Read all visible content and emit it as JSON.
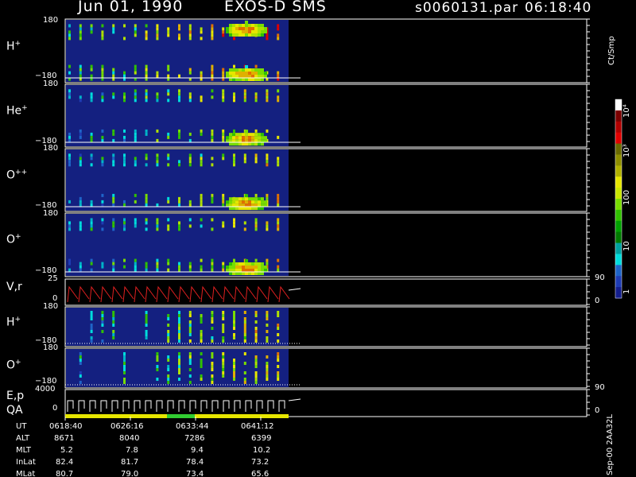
{
  "header": {
    "date": "Jun 01, 1990",
    "instrument": "EXOS-D SMS",
    "file": "s0060131.par",
    "time": "06:18:40"
  },
  "panels": [
    {
      "id": "p1",
      "label": "H",
      "sup": "+",
      "y_top": "180",
      "y_bottom": "−180"
    },
    {
      "id": "p2",
      "label": "He",
      "sup": "+",
      "y_top": "180",
      "y_bottom": "−180"
    },
    {
      "id": "p3",
      "label": "O",
      "sup": "++",
      "y_top": "180",
      "y_bottom": "−180"
    },
    {
      "id": "p4",
      "label": "O",
      "sup": "+",
      "y_top": "180",
      "y_bottom": "−180"
    },
    {
      "id": "p5",
      "label": "V,r",
      "sup": "",
      "y_top": "25",
      "y_bottom": "0",
      "right_top": "90",
      "right_bottom": "0"
    },
    {
      "id": "p6",
      "label": "H",
      "sup": "+",
      "y_top": "180",
      "y_bottom": "−180"
    },
    {
      "id": "p7",
      "label": "O",
      "sup": "+",
      "y_top": "180",
      "y_bottom": "−180"
    },
    {
      "id": "p8",
      "label": "E,p",
      "label2": "QA",
      "sup": "",
      "y_top": "4000",
      "y_bottom": "0",
      "right_top": "90",
      "right_bottom": "0"
    }
  ],
  "colorbar": {
    "unit": "Ct/Smp",
    "ticks": [
      "10⁴",
      "10³",
      "100",
      "10",
      "1"
    ],
    "colors": [
      "#ffffff",
      "#7a0000",
      "#b00000",
      "#e00000",
      "#6a6a00",
      "#8e8e00",
      "#b0b000",
      "#e6e600",
      "#c8e600",
      "#78dc00",
      "#30c000",
      "#00a000",
      "#007a00",
      "#00a0a0",
      "#00dcdc",
      "#1e64c8",
      "#1e3cb4",
      "#141e8c"
    ]
  },
  "footer_note": "Sep-00  2AA32L",
  "table": {
    "row_labels": [
      "UT",
      "ALT",
      "MLT",
      "InLat",
      "MLat"
    ],
    "columns": [
      [
        "0618:40",
        "8671",
        "5.2",
        "82.4",
        "80.7"
      ],
      [
        "0626:16",
        "8040",
        "7.8",
        "81.7",
        "79.0"
      ],
      [
        "0633:44",
        "7286",
        "9.4",
        "78.4",
        "73.4"
      ],
      [
        "0641:12",
        "6399",
        "10.2",
        "73.2",
        "65.6"
      ]
    ]
  },
  "chart_data": {
    "type": "heatmap",
    "title": "Jun 01, 1990   EXOS-D SMS",
    "x_ticks_ut": [
      "0618:40",
      "0626:16",
      "0633:44",
      "0641:12"
    ],
    "panels": [
      {
        "name": "H+",
        "ylim": [
          -180,
          180
        ]
      },
      {
        "name": "He+",
        "ylim": [
          -180,
          180
        ]
      },
      {
        "name": "O++",
        "ylim": [
          -180,
          180
        ]
      },
      {
        "name": "O+",
        "ylim": [
          -180,
          180
        ]
      },
      {
        "name": "V,r",
        "ylim": [
          0,
          25
        ],
        "right_ylim": [
          0,
          90
        ]
      },
      {
        "name": "H+",
        "ylim": [
          -180,
          180
        ]
      },
      {
        "name": "O+",
        "ylim": [
          -180,
          180
        ]
      },
      {
        "name": "E,p / QA",
        "ylim": [
          0,
          4000
        ],
        "right_ylim": [
          0,
          90
        ]
      }
    ],
    "colorbar": {
      "unit": "Ct/Smp",
      "scale": "log",
      "range": [
        1,
        10000
      ]
    },
    "background_color": "#142080",
    "qa_bar_colors": [
      "#e6e600",
      "#32cd32"
    ]
  }
}
